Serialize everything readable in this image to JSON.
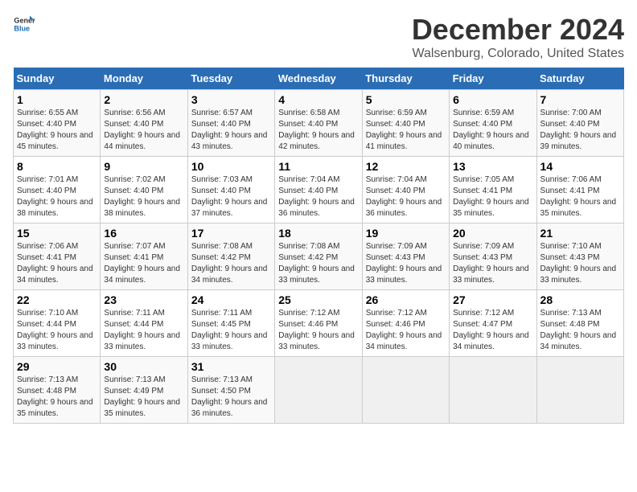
{
  "logo": {
    "text_general": "General",
    "text_blue": "Blue"
  },
  "header": {
    "title": "December 2024",
    "subtitle": "Walsenburg, Colorado, United States"
  },
  "days_of_week": [
    "Sunday",
    "Monday",
    "Tuesday",
    "Wednesday",
    "Thursday",
    "Friday",
    "Saturday"
  ],
  "weeks": [
    [
      {
        "day": 1,
        "sunrise": "6:55 AM",
        "sunset": "4:40 PM",
        "daylight": "9 hours and 45 minutes."
      },
      {
        "day": 2,
        "sunrise": "6:56 AM",
        "sunset": "4:40 PM",
        "daylight": "9 hours and 44 minutes."
      },
      {
        "day": 3,
        "sunrise": "6:57 AM",
        "sunset": "4:40 PM",
        "daylight": "9 hours and 43 minutes."
      },
      {
        "day": 4,
        "sunrise": "6:58 AM",
        "sunset": "4:40 PM",
        "daylight": "9 hours and 42 minutes."
      },
      {
        "day": 5,
        "sunrise": "6:59 AM",
        "sunset": "4:40 PM",
        "daylight": "9 hours and 41 minutes."
      },
      {
        "day": 6,
        "sunrise": "6:59 AM",
        "sunset": "4:40 PM",
        "daylight": "9 hours and 40 minutes."
      },
      {
        "day": 7,
        "sunrise": "7:00 AM",
        "sunset": "4:40 PM",
        "daylight": "9 hours and 39 minutes."
      }
    ],
    [
      {
        "day": 8,
        "sunrise": "7:01 AM",
        "sunset": "4:40 PM",
        "daylight": "9 hours and 38 minutes."
      },
      {
        "day": 9,
        "sunrise": "7:02 AM",
        "sunset": "4:40 PM",
        "daylight": "9 hours and 38 minutes."
      },
      {
        "day": 10,
        "sunrise": "7:03 AM",
        "sunset": "4:40 PM",
        "daylight": "9 hours and 37 minutes."
      },
      {
        "day": 11,
        "sunrise": "7:04 AM",
        "sunset": "4:40 PM",
        "daylight": "9 hours and 36 minutes."
      },
      {
        "day": 12,
        "sunrise": "7:04 AM",
        "sunset": "4:40 PM",
        "daylight": "9 hours and 36 minutes."
      },
      {
        "day": 13,
        "sunrise": "7:05 AM",
        "sunset": "4:41 PM",
        "daylight": "9 hours and 35 minutes."
      },
      {
        "day": 14,
        "sunrise": "7:06 AM",
        "sunset": "4:41 PM",
        "daylight": "9 hours and 35 minutes."
      }
    ],
    [
      {
        "day": 15,
        "sunrise": "7:06 AM",
        "sunset": "4:41 PM",
        "daylight": "9 hours and 34 minutes."
      },
      {
        "day": 16,
        "sunrise": "7:07 AM",
        "sunset": "4:41 PM",
        "daylight": "9 hours and 34 minutes."
      },
      {
        "day": 17,
        "sunrise": "7:08 AM",
        "sunset": "4:42 PM",
        "daylight": "9 hours and 34 minutes."
      },
      {
        "day": 18,
        "sunrise": "7:08 AM",
        "sunset": "4:42 PM",
        "daylight": "9 hours and 33 minutes."
      },
      {
        "day": 19,
        "sunrise": "7:09 AM",
        "sunset": "4:43 PM",
        "daylight": "9 hours and 33 minutes."
      },
      {
        "day": 20,
        "sunrise": "7:09 AM",
        "sunset": "4:43 PM",
        "daylight": "9 hours and 33 minutes."
      },
      {
        "day": 21,
        "sunrise": "7:10 AM",
        "sunset": "4:43 PM",
        "daylight": "9 hours and 33 minutes."
      }
    ],
    [
      {
        "day": 22,
        "sunrise": "7:10 AM",
        "sunset": "4:44 PM",
        "daylight": "9 hours and 33 minutes."
      },
      {
        "day": 23,
        "sunrise": "7:11 AM",
        "sunset": "4:44 PM",
        "daylight": "9 hours and 33 minutes."
      },
      {
        "day": 24,
        "sunrise": "7:11 AM",
        "sunset": "4:45 PM",
        "daylight": "9 hours and 33 minutes."
      },
      {
        "day": 25,
        "sunrise": "7:12 AM",
        "sunset": "4:46 PM",
        "daylight": "9 hours and 33 minutes."
      },
      {
        "day": 26,
        "sunrise": "7:12 AM",
        "sunset": "4:46 PM",
        "daylight": "9 hours and 34 minutes."
      },
      {
        "day": 27,
        "sunrise": "7:12 AM",
        "sunset": "4:47 PM",
        "daylight": "9 hours and 34 minutes."
      },
      {
        "day": 28,
        "sunrise": "7:13 AM",
        "sunset": "4:48 PM",
        "daylight": "9 hours and 34 minutes."
      }
    ],
    [
      {
        "day": 29,
        "sunrise": "7:13 AM",
        "sunset": "4:48 PM",
        "daylight": "9 hours and 35 minutes."
      },
      {
        "day": 30,
        "sunrise": "7:13 AM",
        "sunset": "4:49 PM",
        "daylight": "9 hours and 35 minutes."
      },
      {
        "day": 31,
        "sunrise": "7:13 AM",
        "sunset": "4:50 PM",
        "daylight": "9 hours and 36 minutes."
      },
      null,
      null,
      null,
      null
    ]
  ]
}
